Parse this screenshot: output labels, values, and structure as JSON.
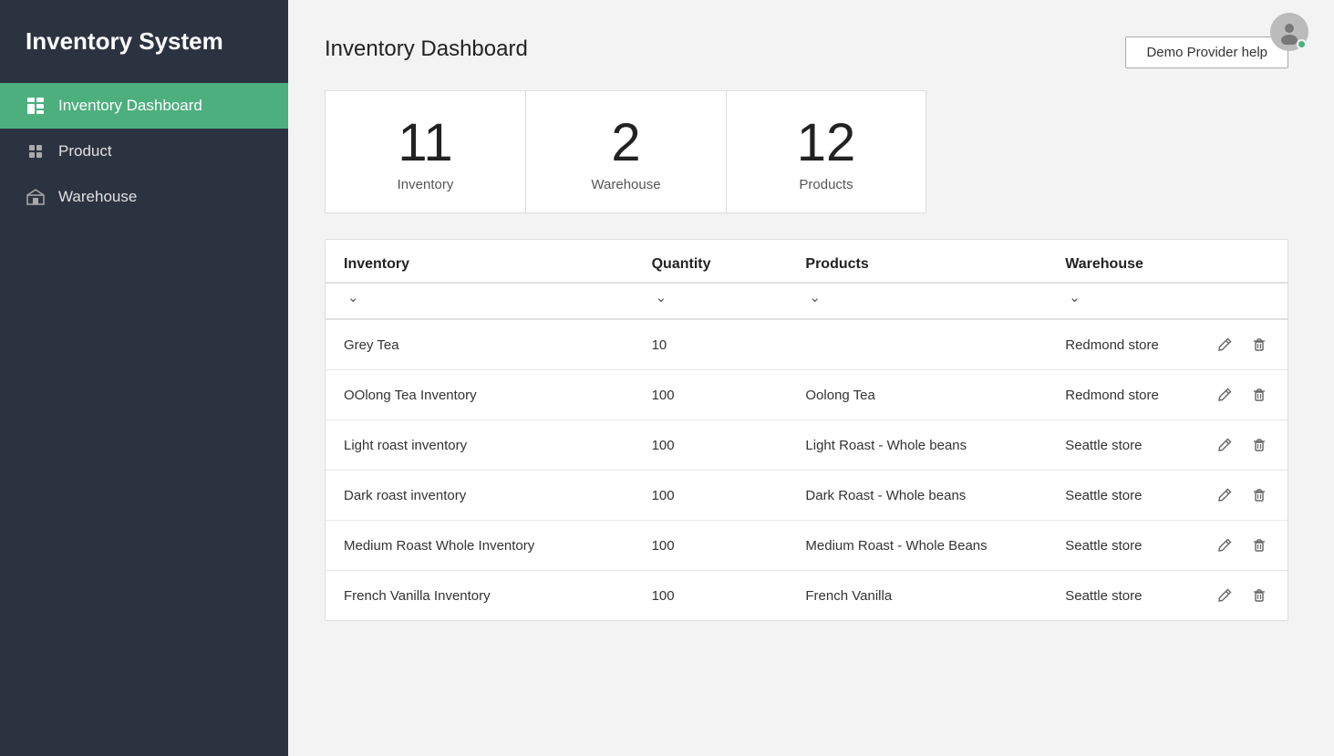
{
  "app": {
    "title": "Inventory System"
  },
  "sidebar": {
    "items": [
      {
        "id": "dashboard",
        "label": "Inventory Dashboard",
        "active": true,
        "icon": "dashboard-icon"
      },
      {
        "id": "product",
        "label": "Product",
        "active": false,
        "icon": "product-icon"
      },
      {
        "id": "warehouse",
        "label": "Warehouse",
        "active": false,
        "icon": "warehouse-icon"
      }
    ]
  },
  "header": {
    "page_title": "Inventory Dashboard",
    "help_button": "Demo Provider help"
  },
  "stats": [
    {
      "number": "11",
      "label": "Inventory"
    },
    {
      "number": "2",
      "label": "Warehouse"
    },
    {
      "number": "12",
      "label": "Products"
    }
  ],
  "table": {
    "columns": [
      "Inventory",
      "Quantity",
      "Products",
      "Warehouse"
    ],
    "rows": [
      {
        "inventory": "Grey Tea",
        "quantity": "10",
        "products": "",
        "warehouse": "Redmond store"
      },
      {
        "inventory": "OOlong Tea Inventory",
        "quantity": "100",
        "products": "Oolong Tea",
        "warehouse": "Redmond store"
      },
      {
        "inventory": "Light roast inventory",
        "quantity": "100",
        "products": "Light Roast - Whole beans",
        "warehouse": "Seattle store"
      },
      {
        "inventory": "Dark roast inventory",
        "quantity": "100",
        "products": "Dark Roast - Whole beans",
        "warehouse": "Seattle store"
      },
      {
        "inventory": "Medium Roast Whole Inventory",
        "quantity": "100",
        "products": "Medium Roast - Whole Beans",
        "warehouse": "Seattle store"
      },
      {
        "inventory": "French Vanilla Inventory",
        "quantity": "100",
        "products": "French Vanilla",
        "warehouse": "Seattle store"
      }
    ]
  }
}
